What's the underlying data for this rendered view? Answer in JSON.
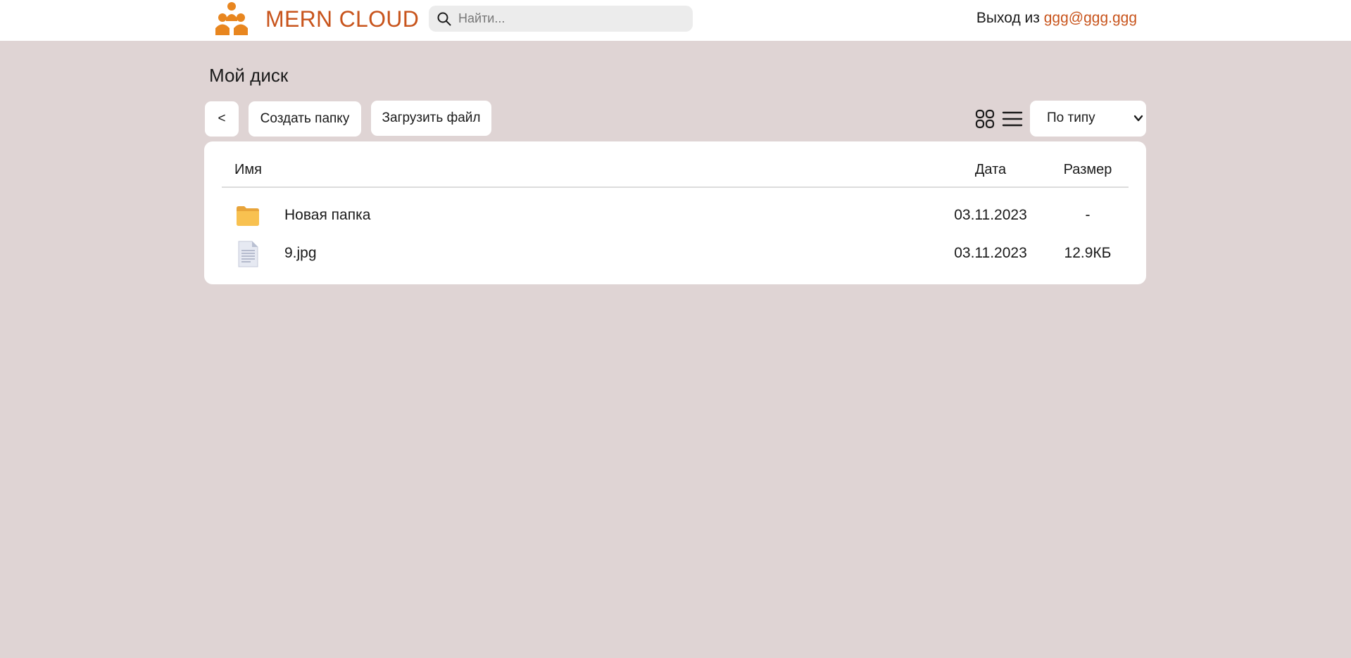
{
  "header": {
    "app_title": "MERN CLOUD",
    "logo_icon": "people-group-icon",
    "brand_color": "#c8541c",
    "search": {
      "placeholder": "Найти...",
      "value": ""
    },
    "logout_prefix": "Выход из",
    "user_email": "ggg@ggg.ggg"
  },
  "toolbar": {
    "page_title": "Мой диск",
    "back_label": "<",
    "create_folder_label": "Создать папку",
    "upload_file_label": "Загрузить файл",
    "view_icons": [
      "grid-view-icon",
      "list-view-icon"
    ],
    "sort_selected": "По типу"
  },
  "file_table": {
    "columns": {
      "name": "Имя",
      "date": "Дата",
      "size": "Размер"
    },
    "rows": [
      {
        "icon": "folder-icon",
        "name": "Новая папка",
        "date": "03.11.2023",
        "size": "-"
      },
      {
        "icon": "file-icon",
        "name": "9.jpg",
        "date": "03.11.2023",
        "size": "12.9КБ"
      }
    ]
  },
  "colors": {
    "background": "#dfd4d4",
    "accent": "#c8541c",
    "folder": "#f6b34b"
  }
}
